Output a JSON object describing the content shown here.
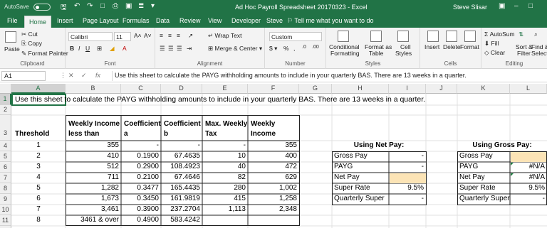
{
  "titlebar": {
    "autosave_label": "AutoSave",
    "autosave_state": "Off",
    "document_title": "Ad Hoc Payroll Spreadsheet 20170323  -  Excel",
    "user_name": "Steve Slisar"
  },
  "tabs": [
    "File",
    "Home",
    "Insert",
    "Page Layout",
    "Formulas",
    "Data",
    "Review",
    "View",
    "Developer",
    "Steve"
  ],
  "active_tab": "Home",
  "tell_me": "Tell me what you want to do",
  "ribbon": {
    "clipboard": {
      "paste": "Paste",
      "cut": "Cut",
      "copy": "Copy",
      "format_painter": "Format Painter",
      "label": "Clipboard"
    },
    "font": {
      "name": "Calibri",
      "size": "11",
      "label": "Font"
    },
    "alignment": {
      "wrap_text": "Wrap Text",
      "merge_center": "Merge & Center",
      "label": "Alignment"
    },
    "number": {
      "format": "Custom",
      "label": "Number"
    },
    "styles": {
      "conditional": "Conditional",
      "conditional2": "Formatting",
      "format_as": "Format as",
      "format_as2": "Table",
      "cell": "Cell",
      "cell2": "Styles",
      "label": "Styles"
    },
    "cells": {
      "insert": "Insert",
      "delete": "Delete",
      "format": "Format",
      "label": "Cells"
    },
    "editing": {
      "autosum": "AutoSum",
      "fill": "Fill",
      "clear": "Clear",
      "sort": "Sort &",
      "sort2": "Filter",
      "find": "Find &",
      "find2": "Select",
      "label": "Editing"
    }
  },
  "formula_bar": {
    "name_box": "A1",
    "fx": "fx",
    "content": "Use this sheet to calculate the PAYG withholding amounts to include in your quarterly BAS. There are 13 weeks in a quarter."
  },
  "columns": [
    "A",
    "B",
    "C",
    "D",
    "E",
    "F",
    "G",
    "H",
    "I",
    "J",
    "K",
    "L"
  ],
  "rows": [
    "1",
    "2",
    "3",
    "4",
    "5",
    "6",
    "7",
    "8",
    "9",
    "10",
    "11",
    "12"
  ],
  "sheet": {
    "a1": "Use this sheet to calculate the PAYG withholding amounts to include in your quarterly BAS. There are 13 weeks in a quarter.",
    "headers": {
      "threshold": "Threshold",
      "weekly_income_less_than_1": "Weekly Income",
      "weekly_income_less_than_2": "less than",
      "coeff_a_1": "Coefficient",
      "coeff_a_2": "a",
      "coeff_b_1": "Coefficient",
      "coeff_b_2": "b",
      "max_weekly_tax_1": "Max. Weekly",
      "max_weekly_tax_2": "Tax",
      "weekly_income_1": "Weekly",
      "weekly_income_2": "Income"
    },
    "table": [
      [
        "1",
        "355",
        "-",
        "-",
        "-",
        "355"
      ],
      [
        "2",
        "410",
        "0.1900",
        "67.4635",
        "10",
        "400"
      ],
      [
        "3",
        "512",
        "0.2900",
        "108.4923",
        "40",
        "472"
      ],
      [
        "4",
        "711",
        "0.2100",
        "67.4646",
        "82",
        "629"
      ],
      [
        "5",
        "1,282",
        "0.3477",
        "165.4435",
        "280",
        "1,002"
      ],
      [
        "6",
        "1,673",
        "0.3450",
        "161.9819",
        "415",
        "1,258"
      ],
      [
        "7",
        "3,461",
        "0.3900",
        "237.2704",
        "1,113",
        "2,348"
      ],
      [
        "8",
        "3461 & over",
        "0.4900",
        "583.4242",
        "",
        ""
      ]
    ],
    "net_pay_box": {
      "title": "Using Net Pay:",
      "rows": [
        [
          "Gross Pay",
          "-"
        ],
        [
          "PAYG",
          "-"
        ],
        [
          "Net Pay",
          ""
        ],
        [
          "Super Rate",
          "9.5%"
        ],
        [
          "Quarterly Super",
          "-"
        ]
      ]
    },
    "gross_pay_box": {
      "title": "Using Gross Pay:",
      "rows": [
        [
          "Gross Pay",
          ""
        ],
        [
          "PAYG",
          "#N/A"
        ],
        [
          "Net Pay",
          "#N/A"
        ],
        [
          "Super Rate",
          "9.5%"
        ],
        [
          "Quarterly Super",
          "-"
        ]
      ]
    }
  },
  "colors": {
    "accent": "#217346",
    "highlight": "#fce4b6",
    "error_marker": "#1a7a3c"
  }
}
